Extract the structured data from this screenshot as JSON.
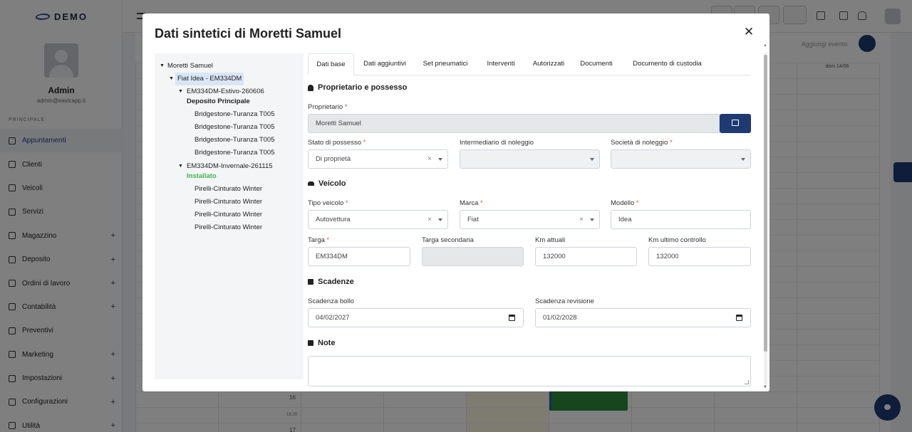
{
  "app": {
    "logo_text": "DEMO",
    "user_name": "Admin",
    "user_email": "admin@eavicapp.it",
    "section_label": "PRINCIPALE",
    "nav": [
      {
        "label": "Appuntamenti",
        "plus": ""
      },
      {
        "label": "Clienti",
        "plus": ""
      },
      {
        "label": "Veicoli",
        "plus": ""
      },
      {
        "label": "Servizi",
        "plus": ""
      },
      {
        "label": "Magazzino",
        "plus": "+"
      },
      {
        "label": "Deposito",
        "plus": "+"
      },
      {
        "label": "Ordini di lavoro",
        "plus": "+"
      },
      {
        "label": "Contabilità",
        "plus": "+"
      },
      {
        "label": "Preventivi",
        "plus": ""
      },
      {
        "label": "Marketing",
        "plus": "+"
      },
      {
        "label": "Impostazioni",
        "plus": "+"
      },
      {
        "label": "Configurazioni",
        "plus": "+"
      },
      {
        "label": "Utilità",
        "plus": "+"
      }
    ],
    "add_event": "Aggiungi evento",
    "day_header": "dom 14/06",
    "hour_16": "16",
    "hour_1630": "16:30",
    "hour_17": "17"
  },
  "modal": {
    "title": "Dati sintetici di Moretti Samuel",
    "close": "✕",
    "tree": {
      "owner": "Moretti Samuel",
      "vehicle": "Fiat Idea - EM334DM",
      "set1": {
        "code": "EM334DM-Estivo-260606",
        "status": "Deposito Principale",
        "tyres": [
          "Bridgestone-Turanza T005",
          "Bridgestone-Turanza T005",
          "Bridgestone-Turanza T005",
          "Bridgestone-Turanza T005"
        ]
      },
      "set2": {
        "code": "EM334DM-Invernale-261115",
        "status": "Installato",
        "tyres": [
          "Pirelli-Cinturato Winter",
          "Pirelli-Cinturato Winter",
          "Pirelli-Cinturato Winter",
          "Pirelli-Cinturato Winter"
        ]
      }
    },
    "tabs": [
      "Dati base",
      "Dati aggiuntivi",
      "Set pneumatici",
      "Interventi",
      "Autorizzati",
      "Documenti",
      "Documento di custodia"
    ],
    "sections": {
      "owner": "Proprietario e possesso",
      "vehicle": "Veicolo",
      "deadlines": "Scadenze",
      "notes": "Note"
    },
    "fields": {
      "owner_label": "Proprietario",
      "owner_value": "Moretti Samuel",
      "possession_label": "Stato di possesso",
      "possession_value": "Di proprietà",
      "broker_label": "Intermediario di noleggio",
      "broker_value": "",
      "rental_label": "Società di noleggio",
      "rental_value": "",
      "type_label": "Tipo veicolo",
      "type_value": "Autovettura",
      "brand_label": "Marca",
      "brand_value": "Fiat",
      "model_label": "Modello",
      "model_value": "Idea",
      "plate_label": "Targa",
      "plate_value": "EM334DM",
      "plate2_label": "Targa secondaria",
      "plate2_value": "",
      "km_label": "Km attuali",
      "km_value": "132000",
      "km_last_label": "Km ultimo controllo",
      "km_last_value": "132000",
      "tax_label": "Scadenza bollo",
      "tax_value": "04/02/2027",
      "review_label": "Scadenza revisione",
      "review_value": "01/02/2028",
      "required_mark": "*",
      "clear_mark": "×"
    }
  }
}
